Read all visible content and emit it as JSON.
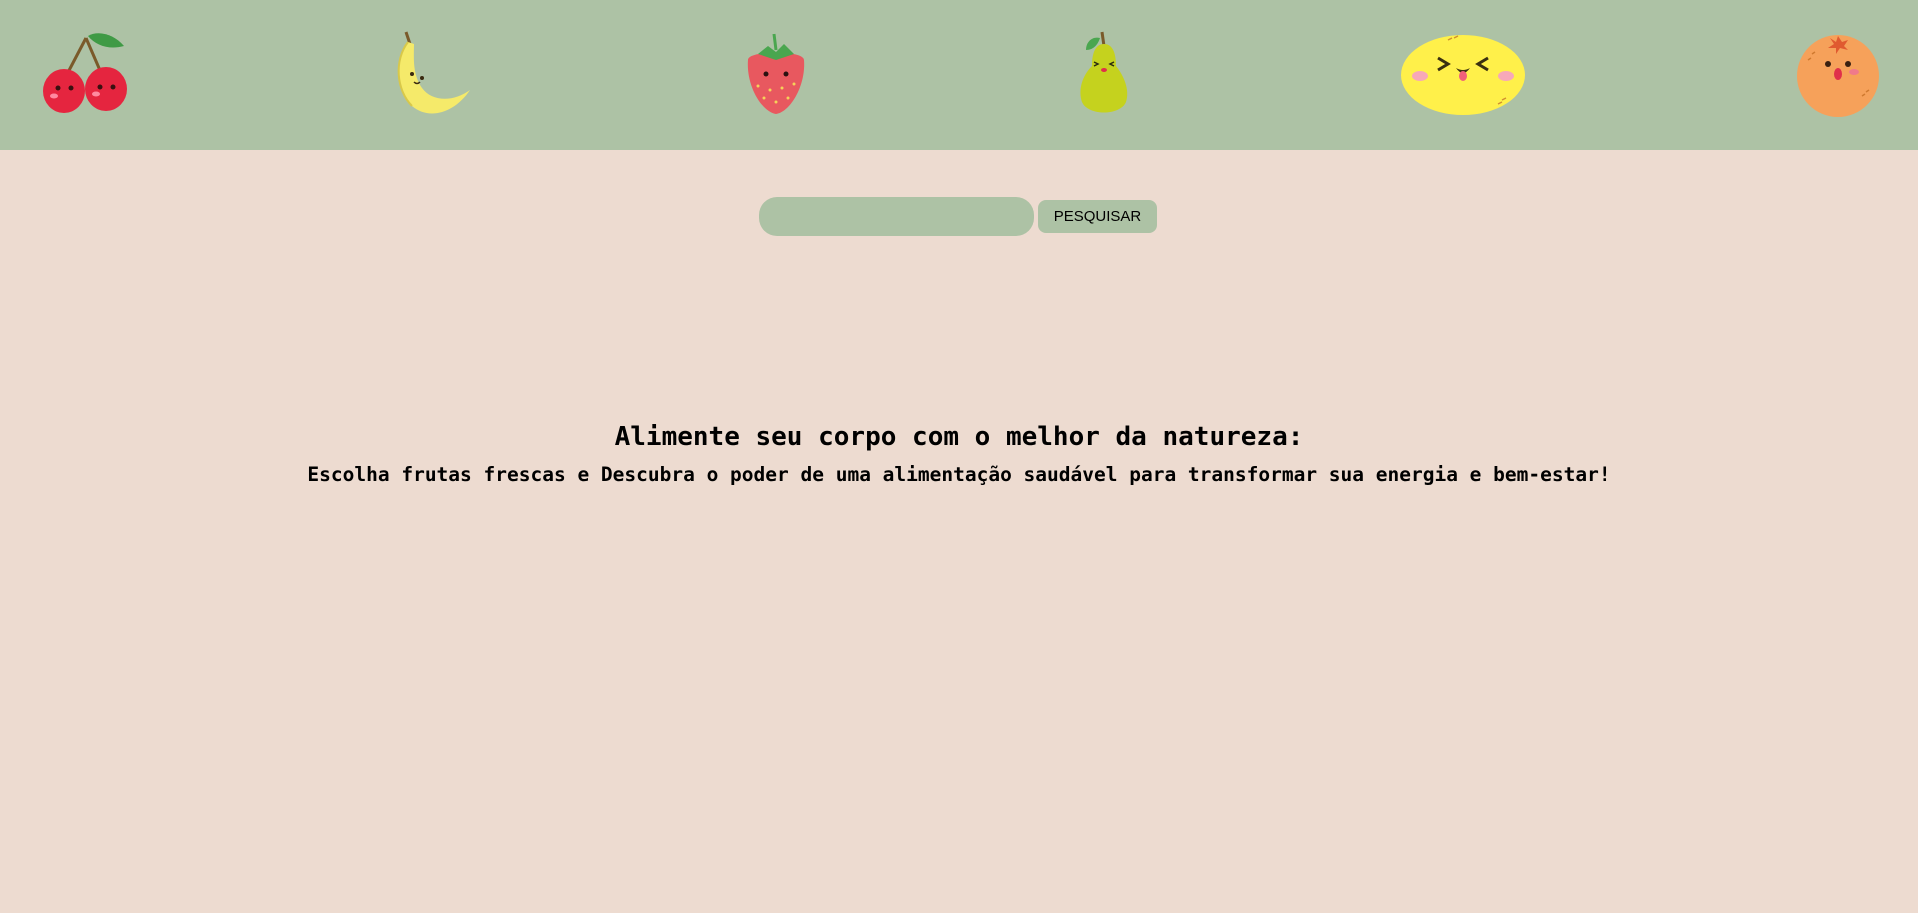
{
  "header": {
    "fruits": [
      {
        "icon": "cherry-icon"
      },
      {
        "icon": "banana-icon"
      },
      {
        "icon": "strawberry-icon"
      },
      {
        "icon": "pear-icon"
      },
      {
        "icon": "lemon-icon"
      },
      {
        "icon": "orange-icon"
      }
    ],
    "background_color": "#adc2a5"
  },
  "search": {
    "value": "",
    "placeholder": "",
    "button_label": "PESQUISAR"
  },
  "hero": {
    "title": "Alimente seu corpo com o melhor da natureza:",
    "subtitle": "Escolha frutas frescas e Descubra o poder de uma alimentação saudável para transformar sua energia e bem-estar!"
  },
  "colors": {
    "page_background": "#eddbd0",
    "accent": "#adc2a5"
  }
}
